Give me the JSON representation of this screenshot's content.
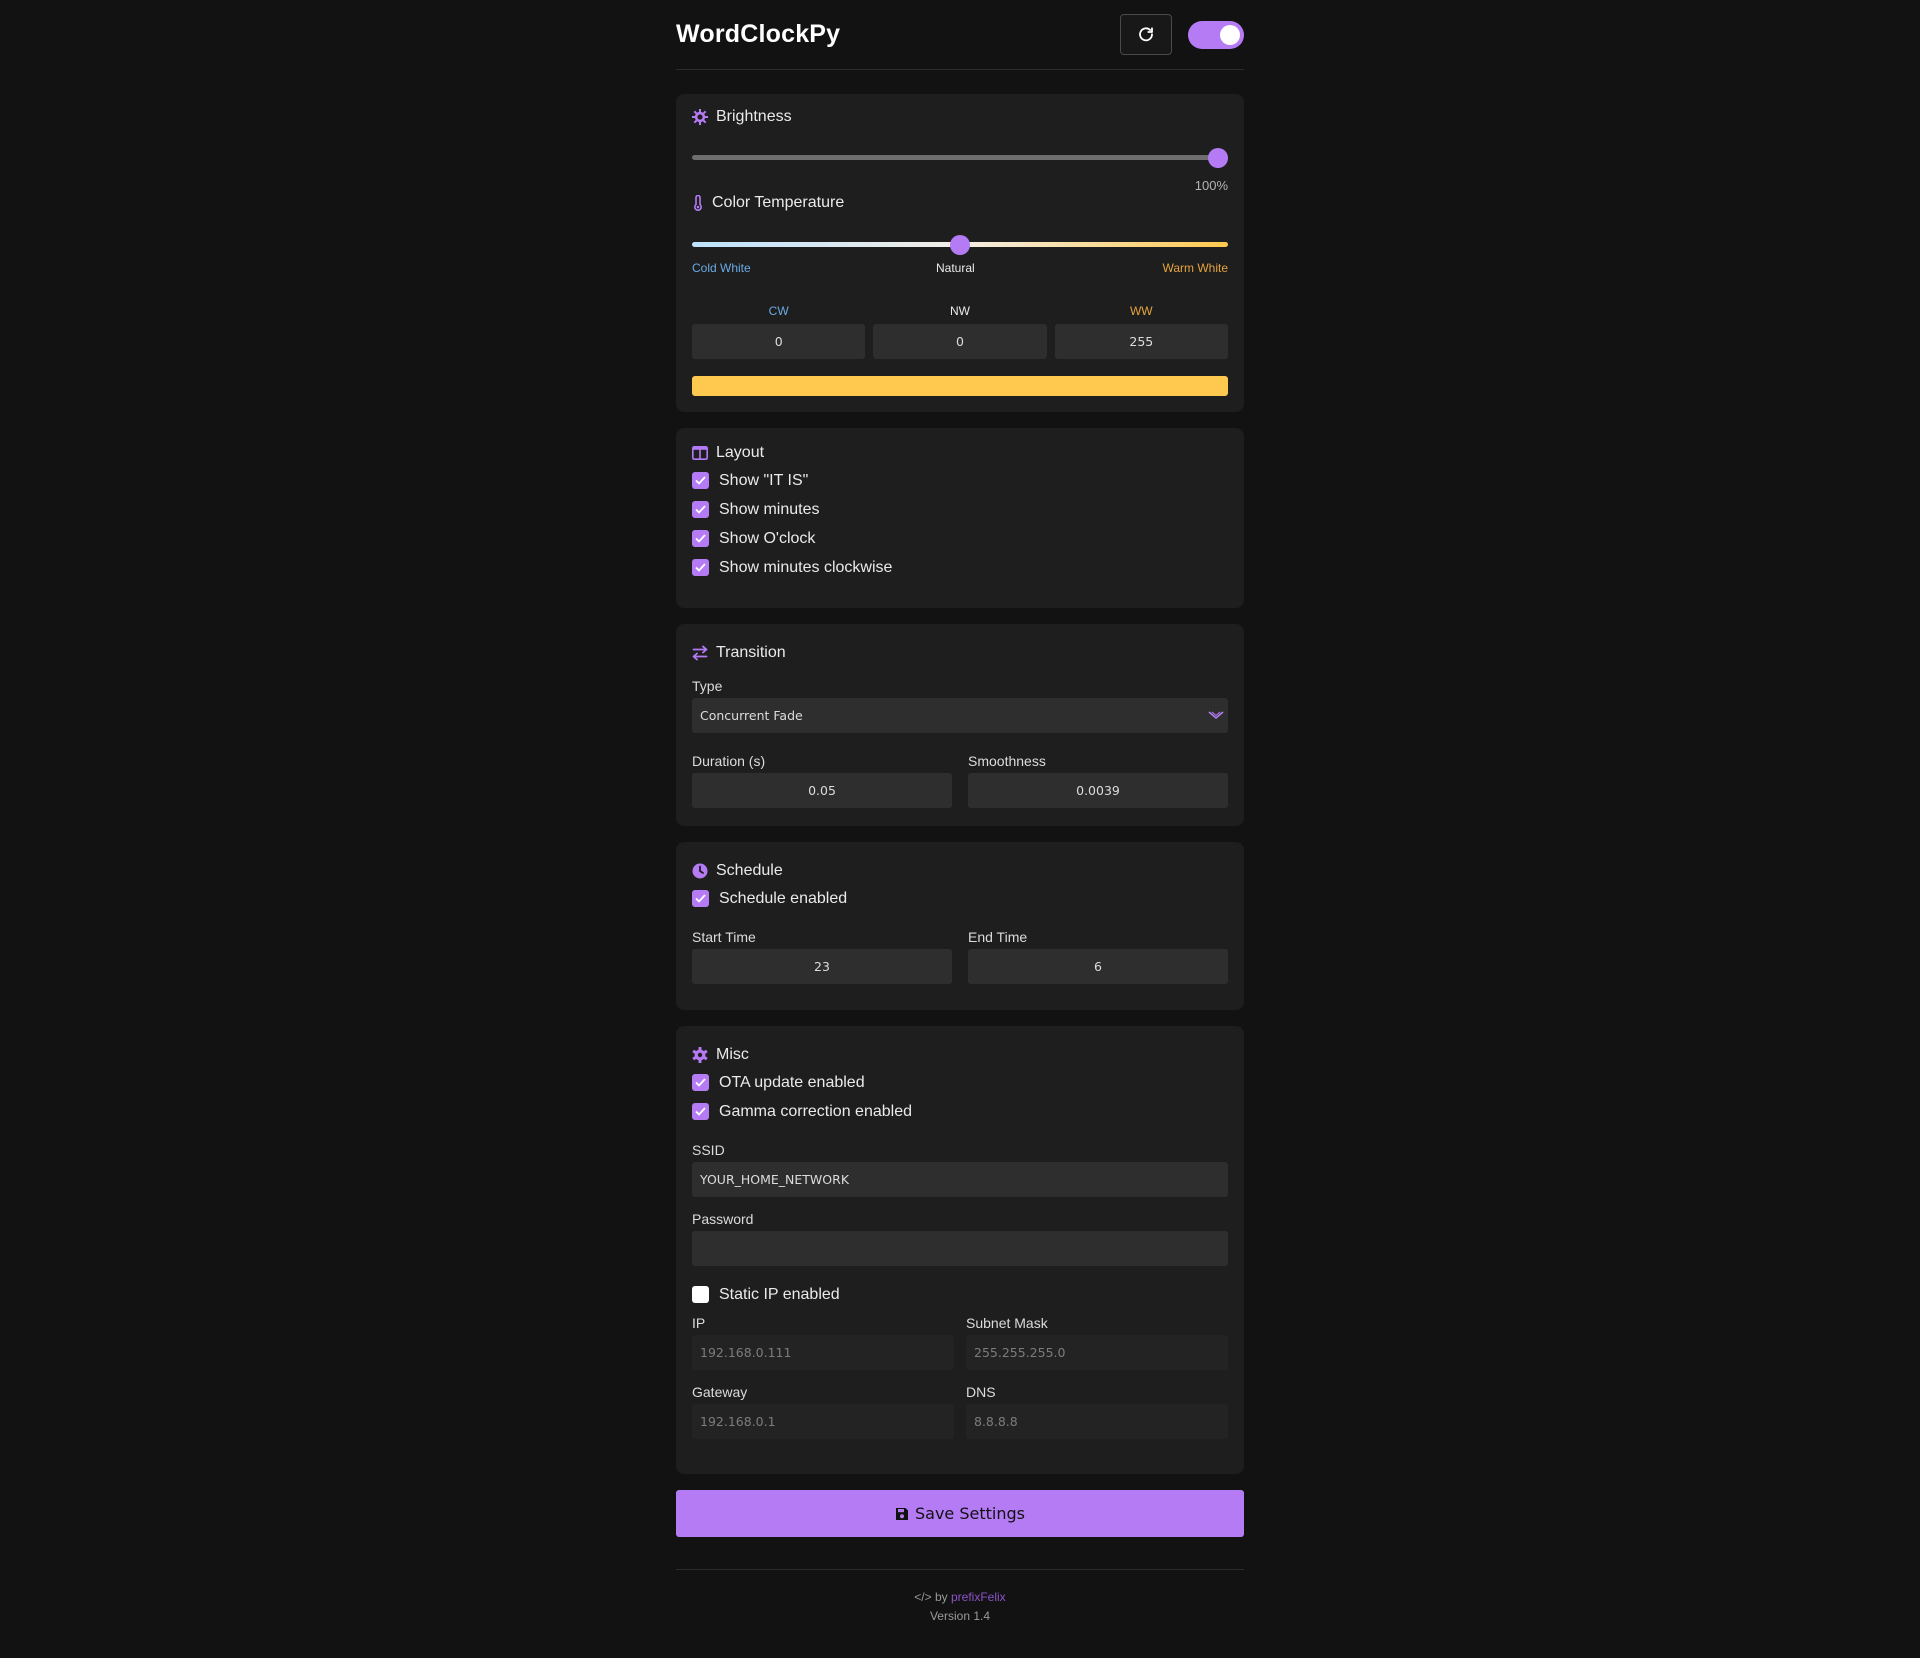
{
  "header": {
    "title": "WordClockPy",
    "power_on": true
  },
  "brightness": {
    "title": "Brightness",
    "value_label": "100%",
    "value": 1.0
  },
  "color_temperature": {
    "title": "Color Temperature",
    "value": 0.5,
    "left_label": "Cold White",
    "middle_label": "Natural",
    "right_label": "Warm White",
    "channels": [
      {
        "label": "CW",
        "value": "0",
        "color": "#6aaae6"
      },
      {
        "label": "NW",
        "value": "0",
        "color": "#eaeaea"
      },
      {
        "label": "WW",
        "value": "255",
        "color": "#e6a23c"
      }
    ],
    "preview_color": "#ffc94f"
  },
  "layout": {
    "title": "Layout",
    "options": [
      {
        "label": "Show \"IT IS\"",
        "checked": true
      },
      {
        "label": "Show minutes",
        "checked": true
      },
      {
        "label": "Show O'clock",
        "checked": true
      },
      {
        "label": "Show minutes clockwise",
        "checked": true
      }
    ]
  },
  "transition": {
    "title": "Transition",
    "type_label": "Type",
    "type_value": "Concurrent Fade",
    "duration_label": "Duration (s)",
    "duration_value": "0.05",
    "smoothness_label": "Smoothness",
    "smoothness_value": "0.0039"
  },
  "schedule": {
    "title": "Schedule",
    "enabled_label": "Schedule enabled",
    "enabled": true,
    "start_label": "Start Time",
    "start_value": "23",
    "end_label": "End Time",
    "end_value": "6"
  },
  "misc": {
    "title": "Misc",
    "ota_label": "OTA update enabled",
    "ota": true,
    "gamma_label": "Gamma correction enabled",
    "gamma": true,
    "ssid_label": "SSID",
    "ssid_value": "YOUR_HOME_NETWORK",
    "password_label": "Password",
    "password_value": "",
    "static_ip_label": "Static IP enabled",
    "static_ip": false,
    "ip_label": "IP",
    "ip_placeholder": "192.168.0.111",
    "subnet_label": "Subnet Mask",
    "subnet_placeholder": "255.255.255.0",
    "gateway_label": "Gateway",
    "gateway_placeholder": "192.168.0.1",
    "dns_label": "DNS",
    "dns_placeholder": "8.8.8.8"
  },
  "save_label": "Save Settings",
  "footer": {
    "code_by": "</> by",
    "author": "prefixFelix",
    "version": "Version 1.4"
  },
  "colors": {
    "accent": "#b57bf5",
    "background": "#121212",
    "card": "#1e1e1e"
  }
}
